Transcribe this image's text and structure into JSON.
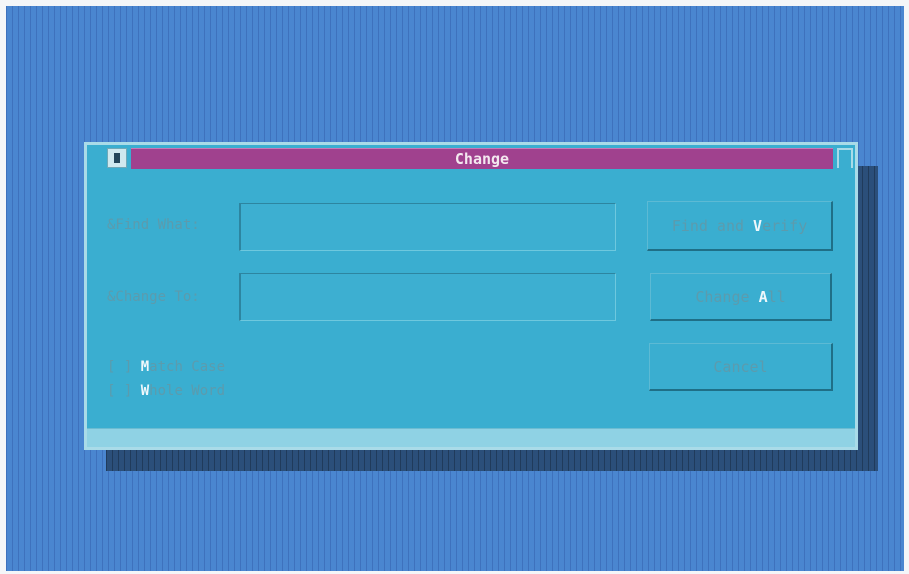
{
  "colors": {
    "desktop": "#4a86d0",
    "dialog": "#3aaed0",
    "titlebar": "#a0418e",
    "text": "#5c9bad",
    "hotkey": "#eef7fb"
  },
  "dialog": {
    "title": "Change",
    "sysmenu_icon": "system-menu-icon",
    "find_what_label": "&Find What:",
    "find_what_value": "",
    "change_to_label": "&Change To:",
    "change_to_value": "",
    "match_case": {
      "box": "[ ] ",
      "hotkey": "M",
      "rest": "atch Case",
      "checked": false
    },
    "whole_word": {
      "box": "[ ] ",
      "hotkey": "W",
      "rest": "hole Word",
      "checked": false
    },
    "buttons": {
      "find_verify": {
        "pre": "Find and ",
        "hotkey": "V",
        "post": "erify"
      },
      "change_all": {
        "pre": "Change ",
        "hotkey": "A",
        "post": "ll"
      },
      "cancel": {
        "pre": "Cancel",
        "hotkey": "",
        "post": ""
      }
    }
  }
}
